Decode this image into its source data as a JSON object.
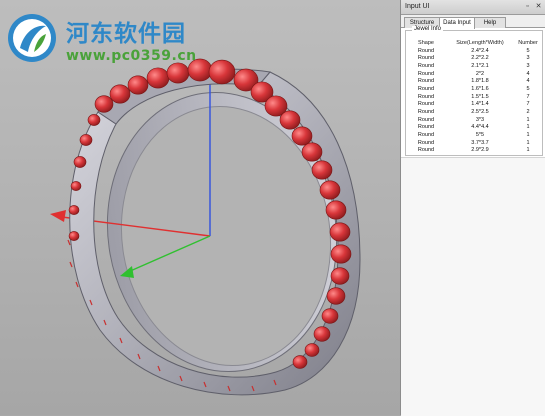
{
  "watermark": {
    "site_name": "河东软件园",
    "url": "www.pc0359.cn"
  },
  "panel": {
    "title": "Input UI",
    "tabs": [
      {
        "label": "Structure"
      },
      {
        "label": "Data Input"
      },
      {
        "label": "Help"
      }
    ],
    "group_label": "Jewel Info",
    "columns": [
      "Shape",
      "Size(Length*Width)",
      "Number"
    ],
    "rows": [
      {
        "shape": "Round",
        "size": "2.4*2.4",
        "number": "5"
      },
      {
        "shape": "Round",
        "size": "2.2*2.2",
        "number": "3"
      },
      {
        "shape": "Round",
        "size": "2.1*2.1",
        "number": "3"
      },
      {
        "shape": "Round",
        "size": "2*2",
        "number": "4"
      },
      {
        "shape": "Round",
        "size": "1.8*1.8",
        "number": "4"
      },
      {
        "shape": "Round",
        "size": "1.6*1.6",
        "number": "5"
      },
      {
        "shape": "Round",
        "size": "1.5*1.5",
        "number": "7"
      },
      {
        "shape": "Round",
        "size": "1.4*1.4",
        "number": "7"
      },
      {
        "shape": "Round",
        "size": "2.5*2.5",
        "number": "2"
      },
      {
        "shape": "Round",
        "size": "3*3",
        "number": "1"
      },
      {
        "shape": "Round",
        "size": "4.4*4.4",
        "number": "1"
      },
      {
        "shape": "Round",
        "size": "5*5",
        "number": "1"
      },
      {
        "shape": "Round",
        "size": "3.7*3.7",
        "number": "1"
      },
      {
        "shape": "Round",
        "size": "2.9*2.9",
        "number": "1"
      }
    ]
  },
  "viewport": {
    "background": "#b0b0b0",
    "ring_color": "#b9b9c2",
    "gem_color": "#d23a3a",
    "axis_x_color": "#e03030",
    "axis_y_color": "#30c030",
    "axis_z_color": "#3050e0"
  }
}
